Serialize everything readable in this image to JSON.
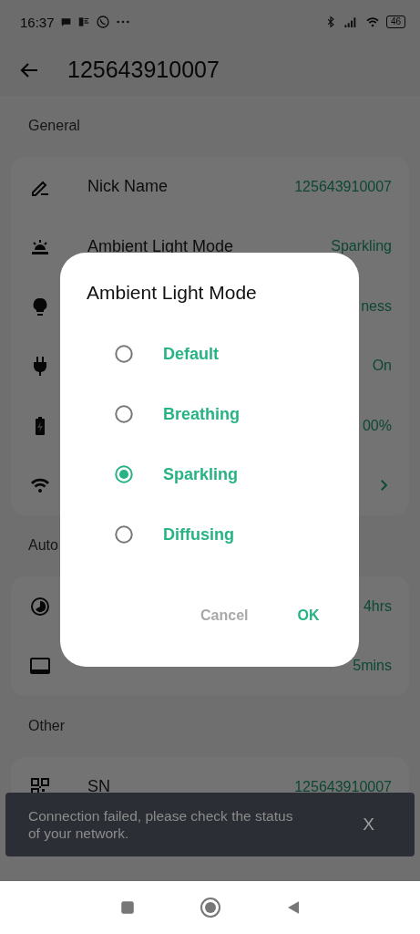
{
  "status_bar": {
    "time": "16:37",
    "battery": "46"
  },
  "header": {
    "title": "125643910007"
  },
  "sections": [
    {
      "title": "General",
      "rows": [
        {
          "label": "Nick Name",
          "value": "125643910007"
        },
        {
          "label": "Ambient Light Mode",
          "value": "Sparkling"
        },
        {
          "value": "ness"
        },
        {
          "value": "On"
        },
        {
          "value": "00%"
        },
        {
          "chevron": true
        }
      ]
    },
    {
      "title": "Auto",
      "rows": [
        {
          "value": "4hrs"
        },
        {
          "value": "5mins"
        }
      ]
    },
    {
      "title": "Other",
      "rows": [
        {
          "label": "SN",
          "value": "125643910007"
        }
      ]
    }
  ],
  "dialog": {
    "title": "Ambient Light Mode",
    "options": [
      {
        "label": "Default",
        "selected": false
      },
      {
        "label": "Breathing",
        "selected": false
      },
      {
        "label": "Sparkling",
        "selected": true
      },
      {
        "label": "Diffusing",
        "selected": false
      }
    ],
    "buttons": [
      {
        "label": "Cancel",
        "kind": "secondary"
      },
      {
        "label": "OK",
        "kind": "primary"
      }
    ]
  },
  "snackbar": {
    "message": "Connection failed, please check the status of your network.",
    "close": "X"
  }
}
